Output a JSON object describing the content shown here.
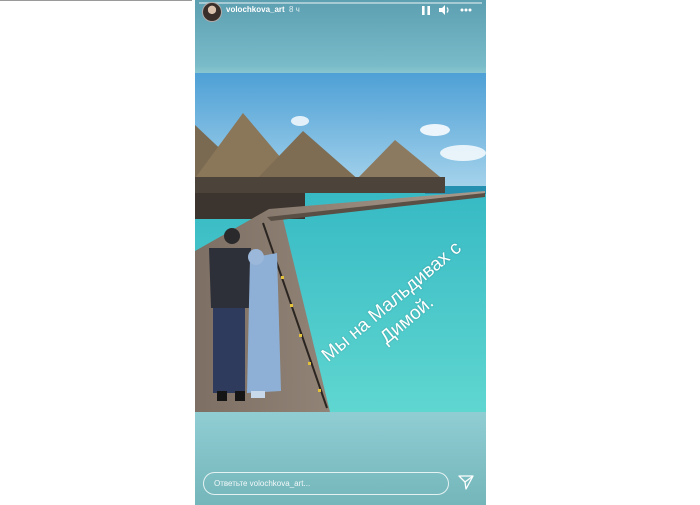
{
  "story": {
    "username": "volochkova_art",
    "time": "8 ч",
    "caption_line1": "Мы на Мальдивах с",
    "caption_line2": "Димой.",
    "reply_placeholder": "Ответьте volochkova_art..."
  },
  "icons": {
    "pause": "pause-icon",
    "sound": "speaker-icon",
    "more": "more-icon",
    "send": "paper-plane-icon"
  },
  "colors": {
    "text": "#ffffff",
    "background_top": "#5c9fb1",
    "background_bottom": "#74b6ba"
  }
}
